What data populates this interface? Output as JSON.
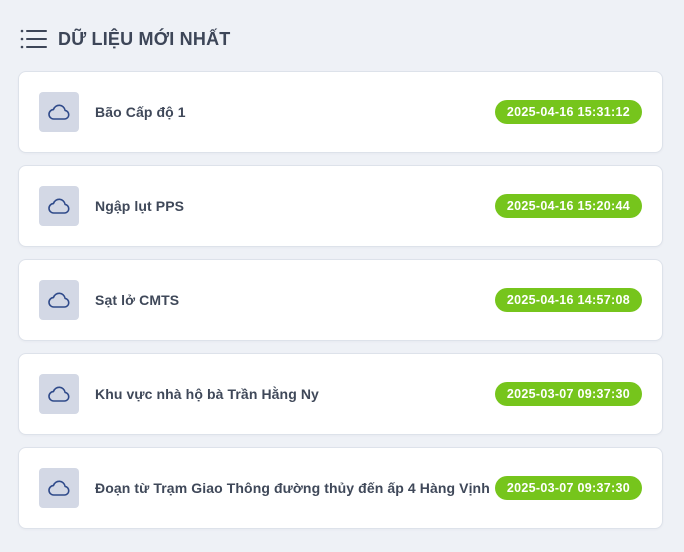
{
  "header": {
    "title": "DỮ LIỆU MỚI NHẤT",
    "icon": "list-icon"
  },
  "items": [
    {
      "label": "Bão Cấp độ 1",
      "timestamp": "2025-04-16 15:31:12",
      "icon": "cloud-icon"
    },
    {
      "label": "Ngập lụt PPS",
      "timestamp": "2025-04-16 15:20:44",
      "icon": "cloud-icon"
    },
    {
      "label": "Sạt lở CMTS",
      "timestamp": "2025-04-16 14:57:08",
      "icon": "cloud-icon"
    },
    {
      "label": "Khu vực nhà hộ bà Trần Hằng Ny",
      "timestamp": "2025-03-07 09:37:30",
      "icon": "cloud-icon"
    },
    {
      "label": "Đoạn từ Trạm Giao Thông đường thủy đến ấp 4 Hàng Vịnh",
      "timestamp": "2025-03-07 09:37:30",
      "icon": "cloud-icon"
    }
  ],
  "colors": {
    "background": "#eef1f6",
    "card": "#ffffff",
    "icon_box": "#d3d8e5",
    "icon_stroke": "#2f4a8a",
    "badge": "#76c51c",
    "text": "#3f4859"
  }
}
